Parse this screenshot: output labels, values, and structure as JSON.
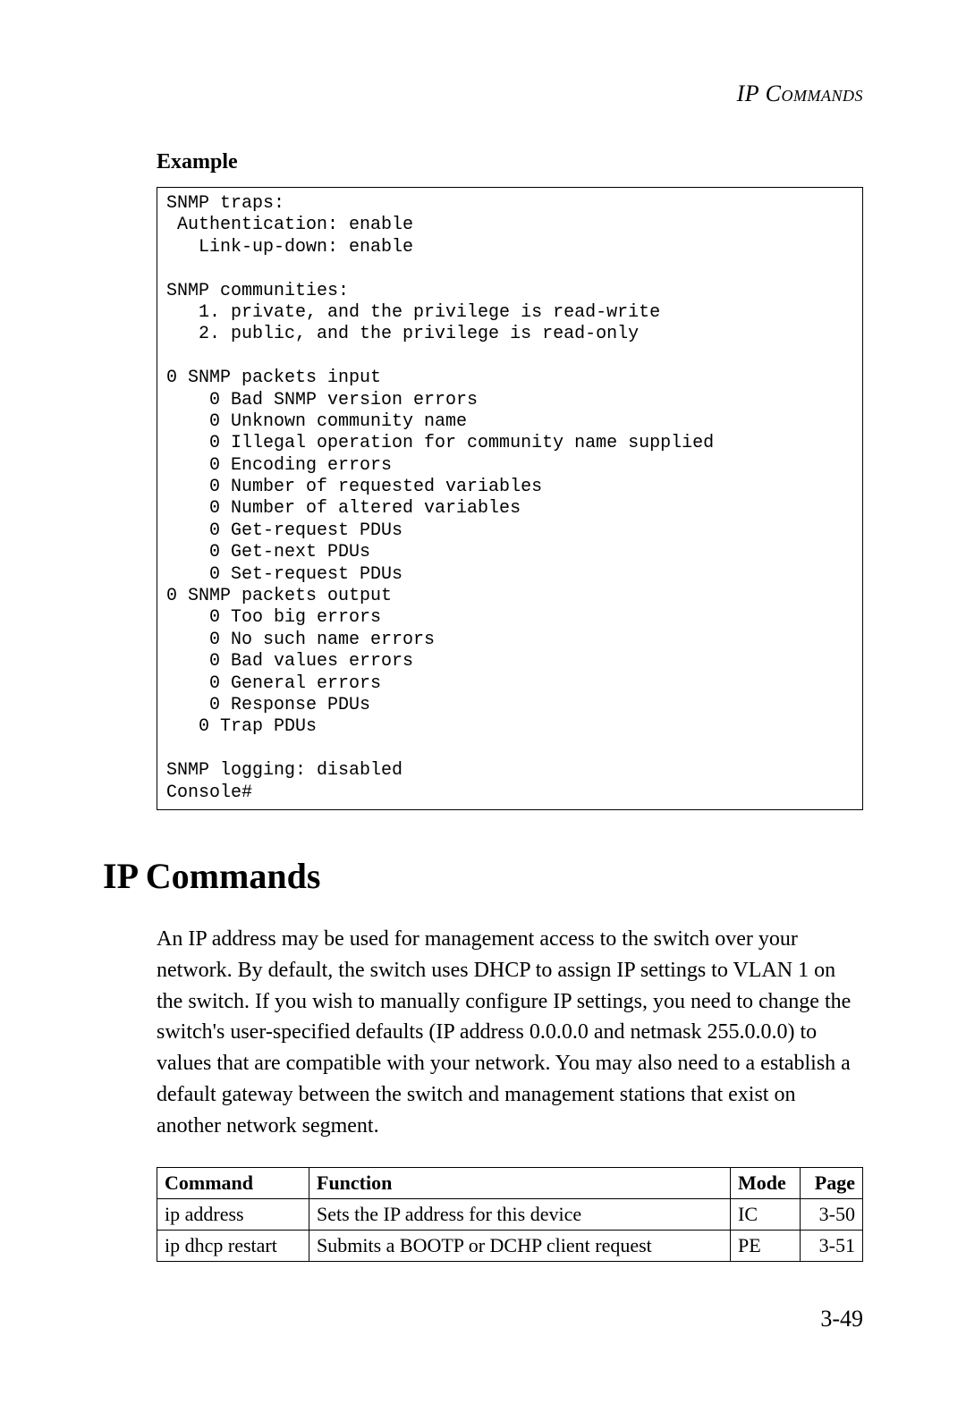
{
  "running_head": "IP Commands",
  "example_label": "Example",
  "code_block": "SNMP traps:\n Authentication: enable\n   Link-up-down: enable\n\nSNMP communities:\n   1. private, and the privilege is read-write\n   2. public, and the privilege is read-only\n\n0 SNMP packets input\n    0 Bad SNMP version errors\n    0 Unknown community name\n    0 Illegal operation for community name supplied\n    0 Encoding errors\n    0 Number of requested variables\n    0 Number of altered variables\n    0 Get-request PDUs\n    0 Get-next PDUs\n    0 Set-request PDUs\n0 SNMP packets output\n    0 Too big errors\n    0 No such name errors\n    0 Bad values errors\n    0 General errors\n    0 Response PDUs\n   0 Trap PDUs\n\nSNMP logging: disabled\nConsole#",
  "section_title": "IP Commands",
  "body_paragraph": "An IP address may be used for management access to the switch over your network. By default, the switch uses DHCP to assign IP settings to VLAN 1 on the switch. If you wish to manually configure IP settings, you need to change the switch's user-specified defaults (IP address 0.0.0.0 and netmask 255.0.0.0) to values that are compatible with your network. You may also need to a establish a default gateway between the switch and management stations that exist on another network segment.",
  "table": {
    "headers": {
      "command": "Command",
      "function": "Function",
      "mode": "Mode",
      "page": "Page"
    },
    "rows": [
      {
        "command": "ip address",
        "function": "Sets the IP address for this device",
        "mode": "IC",
        "page": "3-50"
      },
      {
        "command": "ip dhcp restart",
        "function": "Submits a BOOTP or DCHP client request",
        "mode": "PE",
        "page": "3-51"
      }
    ]
  },
  "page_number": "3-49"
}
